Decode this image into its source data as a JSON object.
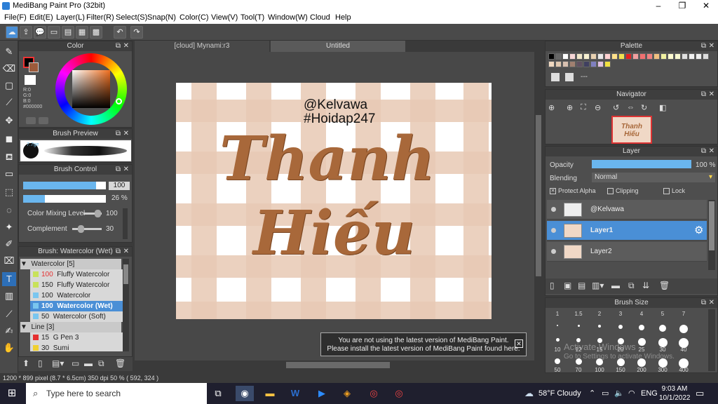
{
  "window": {
    "title": "MediBang Paint Pro (32bit)"
  },
  "menu": [
    "File(F)",
    "Edit(E)",
    "Layer(L)",
    "Filter(R)",
    "Select(S)",
    "Snap(N)",
    "Color(C)",
    "View(V)",
    "Tool(T)",
    "Window(W)",
    "Cloud",
    "Help"
  ],
  "panels": {
    "color": {
      "title": "Color",
      "rgb": [
        "R:0",
        "G:0",
        "B:0"
      ],
      "hex": "#000000"
    },
    "brush_preview": {
      "title": "Brush Preview",
      "size": "7.7ge"
    },
    "brush_control": {
      "title": "Brush Control",
      "size_value": "100",
      "opacity_value": "26 %",
      "mixing_label": "Color Mixing Level",
      "mixing_value": "100",
      "complement_label": "Complement",
      "complement_value": "30"
    },
    "brush_list": {
      "title": "Brush: Watercolor (Wet)",
      "groups": [
        {
          "name": "Watercolor [5]",
          "items": [
            {
              "size": "100",
              "name": "Fluffy Watercolor",
              "color": "#c8e25a"
            },
            {
              "size": "150",
              "name": "Fluffy Watercolor",
              "color": "#c8e25a"
            },
            {
              "size": "100",
              "name": "Watercolor",
              "color": "#7ac6ef"
            },
            {
              "size": "100",
              "name": "Watercolor (Wet)",
              "color": "#7ac6ef"
            },
            {
              "size": "50",
              "name": "Watercolor (Soft)",
              "color": "#7ac6ef"
            }
          ]
        },
        {
          "name": "Line [3]",
          "items": [
            {
              "size": "15",
              "name": "G Pen 3",
              "color": "#e53030"
            },
            {
              "size": "30",
              "name": "Sumi",
              "color": "#f0d030"
            }
          ]
        }
      ]
    },
    "palette": {
      "title": "Palette",
      "dashes": "---"
    },
    "navigator": {
      "title": "Navigator"
    },
    "layer": {
      "title": "Layer",
      "opacity_label": "Opacity",
      "opacity_value": "100 %",
      "blending_label": "Blending",
      "blending_value": "Normal",
      "protect_alpha": "Protect Alpha",
      "clipping": "Clipping",
      "lock": "Lock",
      "layers": [
        {
          "name": "@Kelvawa"
        },
        {
          "name": "Layer1"
        },
        {
          "name": "Layer2"
        }
      ]
    },
    "brush_size": {
      "title": "Brush Size",
      "sizes": [
        "1",
        "1.5",
        "2",
        "3",
        "4",
        "5",
        "7",
        "10",
        "12",
        "15",
        "20",
        "25",
        "30",
        "40",
        "50",
        "70",
        "100",
        "150",
        "200",
        "300",
        "400"
      ]
    }
  },
  "tabs": [
    "[cloud] Mynami:r3",
    "Untitled"
  ],
  "canvas": {
    "line1": "@Kelvawa",
    "line2": "#Hoidap247",
    "script1": "Thanh",
    "script2": "Hiếu"
  },
  "notice": {
    "line1": "You are not using the latest version of MediBang Paint.",
    "line2": "Please install the latest version of MediBang Paint found here."
  },
  "watermark": {
    "line1": "Activate Windows",
    "line2": "Go to Settings to activate Windows."
  },
  "status": {
    "text": "1200 * 899 pixel  (8.7 * 6.5cm)  350 dpi  50 %  ( 592, 324 )"
  },
  "taskbar": {
    "search": "Type here to search",
    "weather": "58°F  Cloudy",
    "lang": "ENG",
    "time": "9:03 AM",
    "date": "10/1/2022"
  },
  "colors": {
    "accent": "#4a8fd6",
    "canvas_pink": "#e8c9b4",
    "script": "#a8683a"
  }
}
